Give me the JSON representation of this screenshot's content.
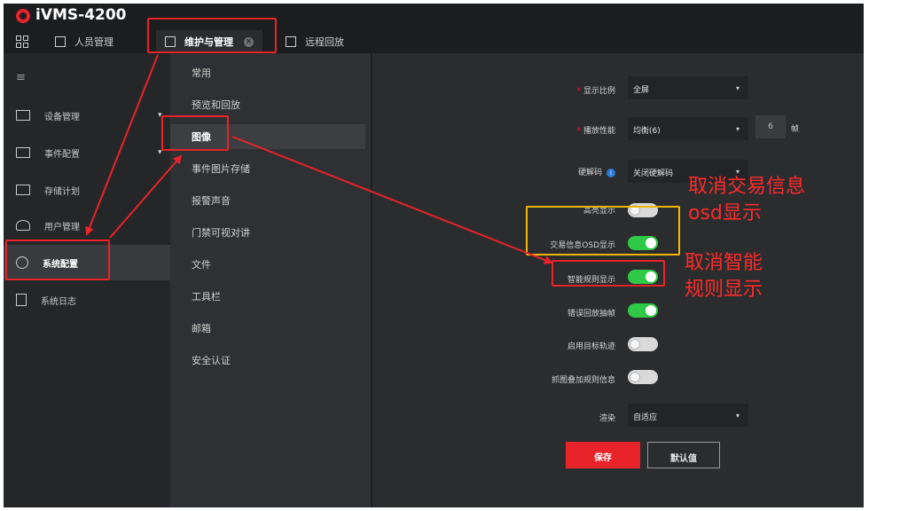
{
  "app": {
    "title": "iVMS-4200"
  },
  "tabs": [
    {
      "label": "人员管理"
    },
    {
      "label": "维护与管理"
    },
    {
      "label": "远程回放"
    }
  ],
  "sidebar": {
    "items": [
      {
        "label": "设备管理",
        "icon": "device-icon"
      },
      {
        "label": "事件配置",
        "icon": "event-icon"
      },
      {
        "label": "存储计划",
        "icon": "storage-icon"
      },
      {
        "label": "用户管理",
        "icon": "user-icon"
      },
      {
        "label": "系统配置",
        "icon": "gear-icon"
      },
      {
        "label": "系统日志",
        "icon": "log-icon"
      }
    ]
  },
  "submenu": {
    "items": [
      {
        "label": "常用"
      },
      {
        "label": "预览和回放"
      },
      {
        "label": "图像"
      },
      {
        "label": "事件图片存储"
      },
      {
        "label": "报警声音"
      },
      {
        "label": "门禁可视对讲"
      },
      {
        "label": "文件"
      },
      {
        "label": "工具栏"
      },
      {
        "label": "邮箱"
      },
      {
        "label": "安全认证"
      }
    ]
  },
  "form": {
    "display_ratio": {
      "label": "显示比例",
      "value": "全屏"
    },
    "playback_performance": {
      "label": "播放性能",
      "value": "均衡(6)",
      "frames": "6",
      "unit": "帧"
    },
    "hardware_decode": {
      "label": "硬解码",
      "value": "关闭硬解码"
    },
    "toggles": [
      {
        "label": "高亮显示",
        "on": false
      },
      {
        "label": "交易信息OSD显示",
        "on": true
      },
      {
        "label": "智能规则显示",
        "on": true
      },
      {
        "label": "错误回放抽帧",
        "on": true
      },
      {
        "label": "启用目标轨迹",
        "on": false
      },
      {
        "label": "抓图叠加规则信息",
        "on": false
      }
    ],
    "render": {
      "label": "渲染",
      "value": "自适应"
    },
    "save_label": "保存",
    "default_label": "默认值"
  },
  "annotations": {
    "note1_line1": "取消交易信息",
    "note1_line2": "osd显示",
    "note2_line1": "取消智能",
    "note2_line2": "规则显示"
  },
  "colors": {
    "accent": "#e8232a",
    "toggle_on": "#2ec946",
    "highlight_box": "#e8232a",
    "highlight_box_alt": "#f5b800"
  }
}
